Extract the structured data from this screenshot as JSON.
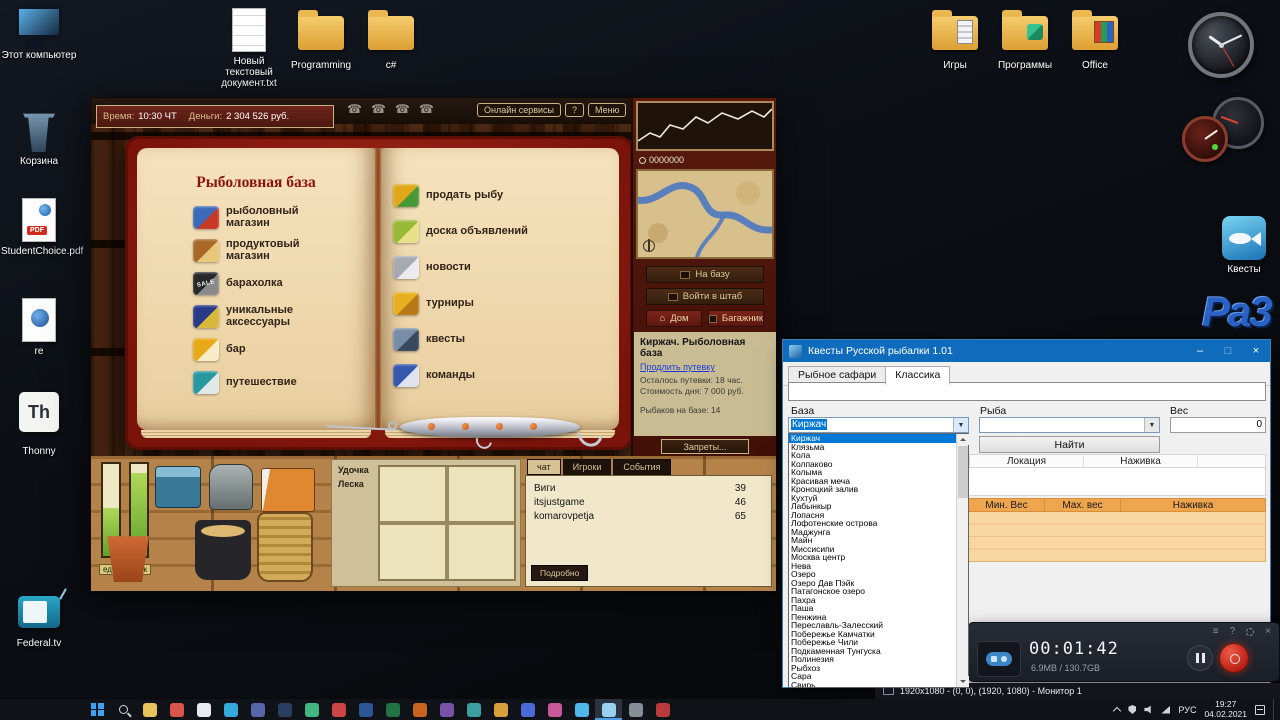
{
  "desktop": {
    "icons_left": [
      {
        "label": "Этот компьютер"
      },
      {
        "label": "Корзина"
      },
      {
        "label": "StudentChoice.pdf"
      },
      {
        "label": "re"
      },
      {
        "label": "Thonny",
        "badge": "Th"
      },
      {
        "label": "Federal.tv"
      }
    ],
    "icons_top": [
      {
        "label": "Новый текстовый документ.txt"
      },
      {
        "label": "Programming"
      },
      {
        "label": "c#"
      }
    ],
    "icons_top_right": [
      {
        "label": "Игры"
      },
      {
        "label": "Программы"
      },
      {
        "label": "Office"
      }
    ],
    "quest_shortcut_label": "Квесты",
    "logo_text": "Ра3"
  },
  "game": {
    "topbar": {
      "time_label": "Время:",
      "time_value": "10:30 ЧТ",
      "money_label": "Деньги:",
      "money_value": "2 304 526 руб.",
      "online_services": "Онлайн сервисы",
      "help": "?",
      "menu": "Меню"
    },
    "book": {
      "title": "Рыболовная база",
      "left_items": [
        {
          "label": "рыболовный магазин",
          "icon": "fishing-rod-icon",
          "c1": "#3a6ab8",
          "c2": "#c83828"
        },
        {
          "label": "продуктовый магазин",
          "icon": "groceries-icon",
          "c1": "#a86828",
          "c2": "#e8c878"
        },
        {
          "label": "барахолка",
          "icon": "sale-tag-icon",
          "c1": "#282828",
          "c2": "#8a8a8a",
          "icon_text": "SALE"
        },
        {
          "label": "уникальные аксессуары",
          "icon": "accessories-icon",
          "c1": "#283a88",
          "c2": "#d8b838"
        },
        {
          "label": "бар",
          "icon": "beer-mugs-icon",
          "c1": "#e8a818",
          "c2": "#f8ecc8"
        },
        {
          "label": "путешествие",
          "icon": "travel-map-icon",
          "c1": "#2898a0",
          "c2": "#e0e8e8"
        }
      ],
      "right_items": [
        {
          "label": "продать рыбу",
          "icon": "sell-fish-icon",
          "c1": "#e0a818",
          "c2": "#489838"
        },
        {
          "label": "доска объявлений",
          "icon": "bulletin-board-icon",
          "c1": "#98b838",
          "c2": "#e8e088"
        },
        {
          "label": "новости",
          "icon": "news-icon",
          "c1": "#a8a8b0",
          "c2": "#ececf0"
        },
        {
          "label": "турниры",
          "icon": "trophy-icon",
          "c1": "#e8b020",
          "c2": "#b87818"
        },
        {
          "label": "квесты",
          "icon": "quest-magnifier-icon",
          "c1": "#788ea8",
          "c2": "#38485e"
        },
        {
          "label": "команды",
          "icon": "teams-flag-icon",
          "c1": "#3858b0",
          "c2": "#dde4ee"
        }
      ]
    },
    "right_panel": {
      "counter": "0000000",
      "to_base": "На базу",
      "enter_hq": "Войти в штаб",
      "home": "Дом",
      "trunk": "Багажник",
      "location_title": "Киржач. Рыболовная база",
      "extend_link": "Продлить путевку",
      "info_line1": "Осталось путевки: 18 час.",
      "info_line2": "Стоимость дня: 7 000 руб.",
      "info_line3": "Рыбаков на базе: 14",
      "bans_button": "Запреты..."
    },
    "bottom": {
      "food_label": "еда",
      "alc_label": "алк",
      "rod_label": "Удочка",
      "line_label": "Леска",
      "tab_chat": "чат",
      "tab_players": "Игроки",
      "tab_events": "События",
      "players": [
        {
          "name": "Виги",
          "value": "39"
        },
        {
          "name": "itsjustgame",
          "value": "46"
        },
        {
          "name": "komarovpetja",
          "value": "65"
        }
      ],
      "details_button": "Подробно"
    }
  },
  "quest_app": {
    "title": "Квесты Русской рыбалки 1.01",
    "tab_safari": "Рыбное сафари",
    "tab_classic": "Классика",
    "label_base": "База",
    "label_fish": "Рыба",
    "label_weight": "Вес",
    "base_value": "Киржач",
    "weight_value": "0",
    "find_button": "Найти",
    "table1_col1": "Локация",
    "table1_col2": "Наживка",
    "table2_col1": "Мин. Вес",
    "table2_col2": "Мах. вес",
    "table2_col3": "Наживка",
    "dropdown_items": [
      "Киржач",
      "Клязьма",
      "Кола",
      "Колпаково",
      "Колыма",
      "Красивая меча",
      "Кроноцкий залив",
      "Кухтуй",
      "Лабынкыр",
      "Лопасня",
      "Лофотенские острова",
      "Маджунга",
      "Майн",
      "Миссисипи",
      "Москва центр",
      "Нева",
      "Озеро",
      "Озеро Дав Пэйк",
      "Патагонское озеро",
      "Пахра",
      "Паша",
      "Пенжина",
      "Переславль-Залесский",
      "Побережье Камчатки",
      "Побережье Чили",
      "Подкаменная Тунгуска",
      "Полинезия",
      "Рыбхоз",
      "Сара",
      "Свирь"
    ],
    "window_buttons": {
      "minimize": "–",
      "maximize": "□",
      "close": "×"
    }
  },
  "recorder": {
    "timer": "00:01:42",
    "size_info": "6.9MB / 130.7GB",
    "status_text": "1920x1080 - (0, 0), (1920, 1080) - Монитор 1",
    "help": "?"
  },
  "taskbar": {
    "lang": "РУС",
    "time": "19:27",
    "date": "04.02.2021",
    "apps": [
      {
        "color": "#e8c25a"
      },
      {
        "color": "#d9544a"
      },
      {
        "color": "#e8eaee"
      },
      {
        "color": "#35aadc"
      },
      {
        "color": "#5865a8"
      },
      {
        "color": "#2a3f5f"
      },
      {
        "color": "#43b581"
      },
      {
        "color": "#cc4444"
      },
      {
        "color": "#2b5797"
      },
      {
        "color": "#217346"
      },
      {
        "color": "#c8641f"
      },
      {
        "color": "#7a52a8"
      },
      {
        "color": "#3aa0a0"
      },
      {
        "color": "#d8a03a"
      },
      {
        "color": "#4a6ad8"
      },
      {
        "color": "#c85898"
      },
      {
        "color": "#50b8e8"
      },
      {
        "color": "#9ad0f0",
        "active": true
      },
      {
        "color": "#888e98"
      },
      {
        "color": "#b83a3a"
      }
    ]
  }
}
